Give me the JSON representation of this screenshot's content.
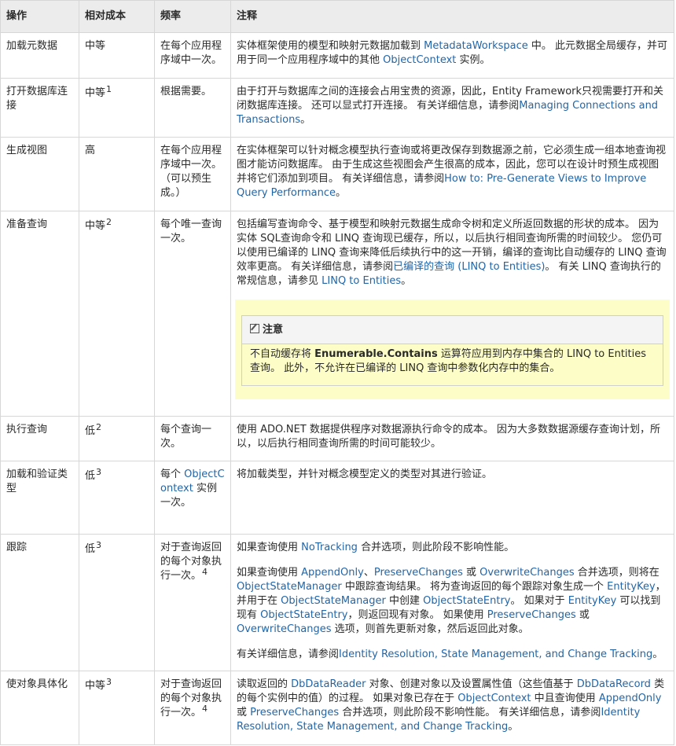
{
  "headers": [
    "操作",
    "相对成本",
    "频率",
    "注释"
  ],
  "rows": {
    "r1": {
      "op": "加载元数据",
      "cost": "中等",
      "freq": "在每个应用程序域中一次。",
      "t1": "实体框架使用的模型和映射元数据加载到 ",
      "l1": "MetadataWorkspace",
      "t2": " 中。 此元数据全局缓存，并可用于同一个应用程序域中的其他 ",
      "l2": "ObjectContext",
      "t3": " 实例。"
    },
    "r2": {
      "op": "打开数据库连接",
      "cost": "中等",
      "sup": "1",
      "freq": "根据需要。",
      "t1": "由于打开与数据库之间的连接会占用宝贵的资源，因此，Entity Framework只视需要打开和关闭数据库连接。 还可以显式打开连接。 有关详细信息，请参阅",
      "l1": "Managing Connections and Transactions",
      "t2": "。"
    },
    "r3": {
      "op": "生成视图",
      "cost": "高",
      "freq": "在每个应用程序域中一次。（可以预生成。）",
      "t1": "在实体框架可以针对概念模型执行查询或将更改保存到数据源之前，它必须生成一组本地查询视图才能访问数据库。 由于生成这些视图会产生很高的成本，因此，您可以在设计时预生成视图并将它们添加到项目。 有关详细信息，请参阅",
      "l1": "How to: Pre-Generate Views to Improve Query Performance",
      "t2": "。"
    },
    "r4": {
      "op": "准备查询",
      "cost": "中等",
      "sup": "2",
      "freq": "每个唯一查询一次。",
      "t1": "包括编写查询命令、基于模型和映射元数据生成命令树和定义所返回数据的形状的成本。 因为实体 SQL查询命令和 LINQ 查询现已缓存，所以，以后执行相同查询所需的时间较少。 您仍可以使用已编译的 LINQ 查询来降低后续执行中的这一开销，编译的查询比自动缓存的 LINQ 查询效率更高。 有关详细信息，请参阅",
      "l1": "已编译的查询 (LINQ to Entities)",
      "t2": "。 有关 LINQ 查询执行的常规信息，请参见 ",
      "l2": "LINQ to Entities",
      "t3": "。",
      "note_title": "注意",
      "note_t1": "不自动缓存将 ",
      "note_bold": "Enumerable.Contains",
      "note_t2": " 运算符应用到内存中集合的 LINQ to Entities 查询。 此外，不允许在已编译的 LINQ 查询中参数化内存中的集合。"
    },
    "r5": {
      "op": "执行查询",
      "cost": "低",
      "sup": "2",
      "freq": "每个查询一次。",
      "t1": "使用 ADO.NET 数据提供程序对数据源执行命令的成本。 因为大多数数据源缓存查询计划，所以，以后执行相同查询所需的时间可能较少。"
    },
    "r6": {
      "op": "加载和验证类型",
      "cost": "低",
      "sup": "3",
      "freq_t1": "每个 ",
      "freq_l1": "ObjectContext",
      "freq_t2": " 实例一次。",
      "t1": "将加载类型，并针对概念模型定义的类型对其进行验证。"
    },
    "r7": {
      "op": "跟踪",
      "cost": "低",
      "sup": "3",
      "freq": "对于查询返回的每个对象执行一次。",
      "freq_sup": "4",
      "p1_t1": "如果查询使用 ",
      "p1_l1": "NoTracking",
      "p1_t2": " 合并选项，则此阶段不影响性能。",
      "p2_t1": "如果查询使用 ",
      "p2_l1": "AppendOnly",
      "p2_t2": "、",
      "p2_l2": "PreserveChanges",
      "p2_t3": " 或 ",
      "p2_l3": "OverwriteChanges",
      "p2_t4": " 合并选项，则将在 ",
      "p2_l4": "ObjectStateManager",
      "p2_t5": " 中跟踪查询结果。 将为查询返回的每个跟踪对象生成一个 ",
      "p2_l5": "EntityKey",
      "p2_t6": "，并用于在 ",
      "p2_l6": "ObjectStateManager",
      "p2_t7": " 中创建 ",
      "p2_l7": "ObjectStateEntry",
      "p2_t8": "。 如果对于 ",
      "p2_l8": "EntityKey",
      "p2_t9": " 可以找到现有 ",
      "p2_l9": "ObjectStateEntry",
      "p2_t10": "，则返回现有对象。 如果使用 ",
      "p2_l10": "PreserveChanges",
      "p2_t11": " 或 ",
      "p2_l11": "OverwriteChanges",
      "p2_t12": " 选项，则首先更新对象，然后返回此对象。",
      "p3_t1": "有关详细信息，请参阅",
      "p3_l1": "Identity Resolution, State Management, and Change Tracking",
      "p3_t2": "。"
    },
    "r8": {
      "op": "使对象具体化",
      "cost": "中等",
      "sup": "3",
      "freq": "对于查询返回的每个对象执行一次。",
      "freq_sup": "4",
      "t1": "读取返回的 ",
      "l1": "DbDataReader",
      "t2": " 对象、创建对象以及设置属性值（这些值基于 ",
      "l2": "DbDataRecord",
      "t3": " 类的每个实例中的值）的过程。 如果对象已存在于 ",
      "l3": "ObjectContext",
      "t4": " 中且查询使用 ",
      "l4": "AppendOnly",
      "t5": " 或 ",
      "l5": "PreserveChanges",
      "t6": " 合并选项，则此阶段不影响性能。 有关详细信息，请参阅",
      "l6": "Identity Resolution, State Management, and Change Tracking",
      "t7": "。"
    }
  },
  "colors": {
    "link": "#2266a8",
    "header_bg": "#ececec",
    "note_bg": "#fdfdc8",
    "border": "#d7d7d7"
  }
}
